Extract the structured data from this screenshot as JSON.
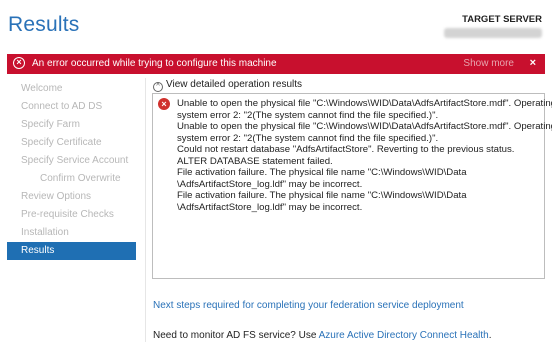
{
  "header": {
    "title": "Results",
    "target_label": "TARGET SERVER",
    "target_value": ""
  },
  "error_bar": {
    "message": "An error occurred while trying to configure this machine",
    "show_more": "Show more",
    "close": "×",
    "color": "#c8102e"
  },
  "nav": {
    "items": [
      {
        "label": "Welcome"
      },
      {
        "label": "Connect to AD DS"
      },
      {
        "label": "Specify Farm"
      },
      {
        "label": "Specify Certificate"
      },
      {
        "label": "Specify Service Account"
      },
      {
        "label": "Confirm Overwrite"
      },
      {
        "label": "Review Options"
      },
      {
        "label": "Pre-requisite Checks"
      },
      {
        "label": "Installation"
      },
      {
        "label": "Results"
      }
    ],
    "active_color": "#1f6fb3"
  },
  "details": {
    "toggle_label": "View detailed operation results",
    "toggle_symbol": "^",
    "error_symbol": "×",
    "lines": [
      "Unable to open the physical file \"C:\\Windows\\WID\\Data\\AdfsArtifactStore.mdf\". Operating",
      "system error 2: \"2(The system cannot find the file specified.)\".",
      "Unable to open the physical file \"C:\\Windows\\WID\\Data\\AdfsArtifactStore.mdf\". Operating",
      "system error 2: \"2(The system cannot find the file specified.)\".",
      "Could not restart database \"AdfsArtifactStore\". Reverting to the previous status.",
      "ALTER DATABASE statement failed.",
      "File activation failure. The physical file name \"C:\\Windows\\WID\\Data",
      "\\AdfsArtifactStore_log.ldf\" may be incorrect.",
      "File activation failure. The physical file name \"C:\\Windows\\WID\\Data",
      "\\AdfsArtifactStore_log.ldf\" may be incorrect."
    ]
  },
  "footer": {
    "next_steps": "Next steps required for completing your federation service deployment",
    "monitor_prefix": "Need to monitor AD FS service? Use ",
    "monitor_link": "Azure Active Directory Connect Health",
    "monitor_suffix": "."
  },
  "colors": {
    "title": "#2a72b8",
    "link": "#2a72b8",
    "error_icon": "#d0312d"
  }
}
